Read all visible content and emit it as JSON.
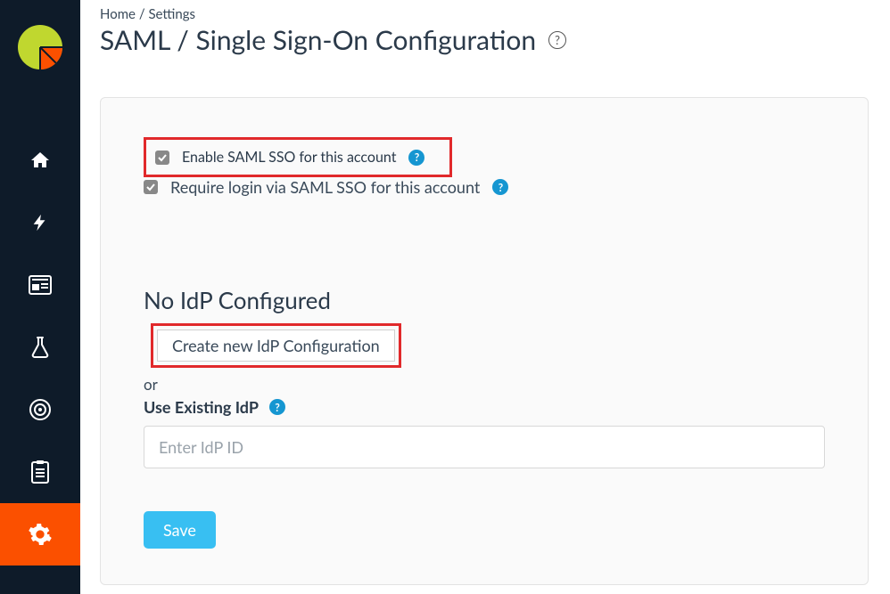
{
  "breadcrumb": {
    "home": "Home",
    "settings": "Settings"
  },
  "page_title": "SAML / Single Sign-On Configuration",
  "options": {
    "enable_label": "Enable SAML SSO for this account",
    "enable_checked": true,
    "require_label": "Require login via SAML SSO for this account",
    "require_checked": true
  },
  "idp": {
    "heading": "No IdP Configured",
    "create_button": "Create new IdP Configuration",
    "or_text": "or",
    "use_existing_label": "Use Existing IdP",
    "input_placeholder": "Enter IdP ID",
    "input_value": ""
  },
  "actions": {
    "save": "Save"
  },
  "sidebar": {
    "items": [
      {
        "name": "home-icon"
      },
      {
        "name": "bolt-icon"
      },
      {
        "name": "news-icon"
      },
      {
        "name": "flask-icon"
      },
      {
        "name": "target-icon"
      },
      {
        "name": "clipboard-icon"
      },
      {
        "name": "gear-icon"
      }
    ],
    "active_index": 6
  },
  "colors": {
    "sidebar_bg": "#0e1b29",
    "accent_orange": "#fb5000",
    "highlight_red": "#e1292b",
    "help_blue": "#1596d1",
    "save_blue": "#38bff2",
    "logo_green": "#c0d72f",
    "logo_orange": "#fb5000"
  }
}
